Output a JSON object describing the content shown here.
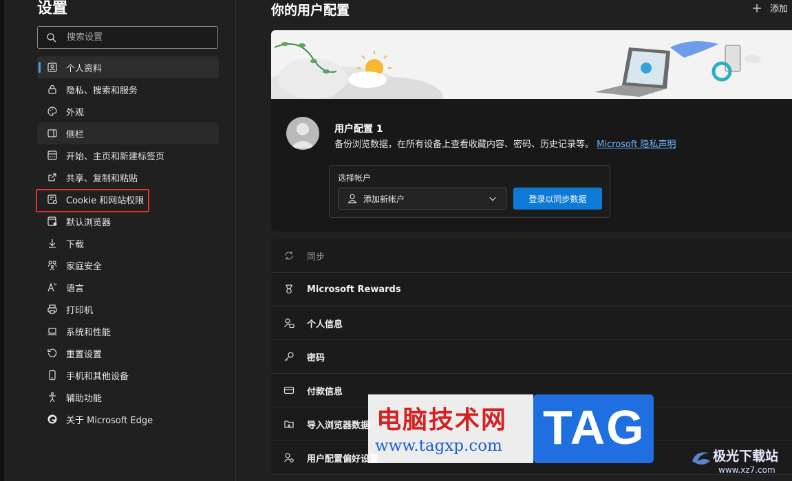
{
  "sidebar": {
    "title": "设置",
    "search_placeholder": "搜索设置",
    "items": [
      {
        "label": "个人资料",
        "icon": "profile-icon"
      },
      {
        "label": "隐私、搜索和服务",
        "icon": "lock-icon"
      },
      {
        "label": "外观",
        "icon": "palette-icon"
      },
      {
        "label": "侧栏",
        "icon": "sidebar-icon"
      },
      {
        "label": "开始、主页和新建标签页",
        "icon": "home-tab-icon"
      },
      {
        "label": "共享、复制和粘贴",
        "icon": "share-icon"
      },
      {
        "label": "Cookie 和网站权限",
        "icon": "cookie-icon"
      },
      {
        "label": "默认浏览器",
        "icon": "browser-icon"
      },
      {
        "label": "下载",
        "icon": "download-icon"
      },
      {
        "label": "家庭安全",
        "icon": "family-icon"
      },
      {
        "label": "语言",
        "icon": "language-icon"
      },
      {
        "label": "打印机",
        "icon": "printer-icon"
      },
      {
        "label": "系统和性能",
        "icon": "laptop-icon"
      },
      {
        "label": "重置设置",
        "icon": "reset-icon"
      },
      {
        "label": "手机和其他设备",
        "icon": "phone-icon"
      },
      {
        "label": "辅助功能",
        "icon": "accessibility-icon"
      },
      {
        "label": "关于 Microsoft Edge",
        "icon": "edge-logo-icon"
      }
    ]
  },
  "main": {
    "title": "你的用户配置",
    "add_profile_label": "添加"
  },
  "profile": {
    "name": "用户配置 1",
    "description": "备份浏览数据，在所有设备上查看收藏内容、密码、历史记录等。",
    "privacy_link": "Microsoft 隐私声明",
    "account_label": "选择帐户",
    "account_value": "添加新帐户",
    "signin_button": "登录以同步数据"
  },
  "settings_list": [
    {
      "label": "同步",
      "icon": "sync-icon",
      "disabled": true
    },
    {
      "label": "Microsoft Rewards",
      "icon": "rewards-icon"
    },
    {
      "label": "个人信息",
      "icon": "personal-info-icon"
    },
    {
      "label": "密码",
      "icon": "key-icon"
    },
    {
      "label": "付款信息",
      "icon": "card-icon"
    },
    {
      "label": "导入浏览器数据",
      "icon": "import-icon"
    },
    {
      "label": "用户配置偏好设置",
      "icon": "profile-prefs-icon"
    }
  ],
  "watermark": {
    "cn": "电脑技术网",
    "url": "www.tagxp.com",
    "tag": "TAG",
    "site2": "极光下载站",
    "site2_url": "www.xz7.com"
  },
  "colors": {
    "accent": "#4aa0e6",
    "button": "#0f7ad6",
    "highlight": "#e0342a",
    "link": "#6cb6ff"
  }
}
